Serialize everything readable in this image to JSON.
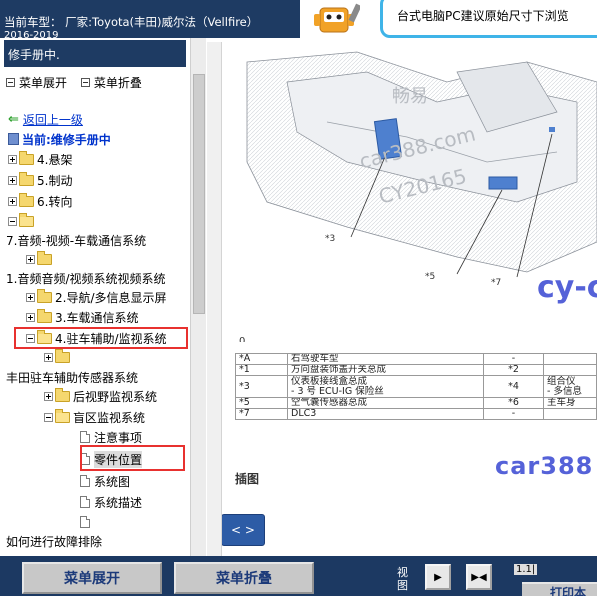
{
  "header": {
    "model_line": "当前车型： 厂家:Toyota(丰田)威尔法（Vellfire）",
    "year_line": "2016-2019"
  },
  "ad": {
    "text": "台式电脑PC建议原始尺寸下浏览"
  },
  "sidebar": {
    "title": "修手册中.",
    "toolbar": {
      "expand_label": "菜单展开",
      "collapse_label": "菜单折叠"
    },
    "back_label": "返回上一级",
    "current_label": "当前:维修手册中",
    "tree": [
      {
        "label": "4.悬架"
      },
      {
        "label": "5.制动"
      },
      {
        "label": "6.转向"
      },
      {
        "label": ""
      },
      {
        "label": "7.音频-视频-车载通信系统"
      },
      {
        "label": ""
      },
      {
        "label": "1.音频音频/视频系统视频系统"
      },
      {
        "label": "2.导航/多信息显示屏"
      },
      {
        "label": "3.车载通信系统"
      },
      {
        "label": "4.驻车辅助/监视系统"
      },
      {
        "label": ""
      },
      {
        "label": "丰田驻车辅助传感器系统"
      },
      {
        "label": "后视野监视系统"
      },
      {
        "label": "盲区监视系统"
      },
      {
        "label": "注意事项"
      },
      {
        "label": "零件位置"
      },
      {
        "label": "系统图"
      },
      {
        "label": "系统描述"
      },
      {
        "label": ""
      },
      {
        "label": "如何进行故障排除"
      }
    ]
  },
  "content": {
    "watermarks": [
      "畅易",
      "car388.com",
      "CY20165",
      "cy-c"
    ],
    "callouts": [
      "*3",
      "*5",
      "*7"
    ],
    "zero_label": "0",
    "table": [
      [
        "*A",
        "右驾驶车型",
        "-",
        ""
      ],
      [
        "*1",
        "方向盘装饰盖开关总成",
        "*2",
        ""
      ],
      [
        "*3",
        "仪表板接线盒总成\n- 3 号 ECU-IG 保险丝",
        "*4",
        "组合仪\n- 多信息"
      ],
      [
        "*5",
        "空气囊传感器总成",
        "*6",
        "主车身"
      ],
      [
        "*7",
        "DLC3",
        "-",
        ""
      ]
    ],
    "caption": "插图",
    "bottom_watermark": "car388",
    "nav_button": "< >"
  },
  "bottombar": {
    "expand_label": "菜单展开",
    "collapse_label": "菜单折叠",
    "view_label": "视图",
    "zoom": "1.1|",
    "next_label": "打印本"
  },
  "colors": {
    "header_bg": "#1e3b63",
    "highlight": "#e8312f",
    "link": "#0033cc",
    "watermark_blue": "#5562d8"
  }
}
